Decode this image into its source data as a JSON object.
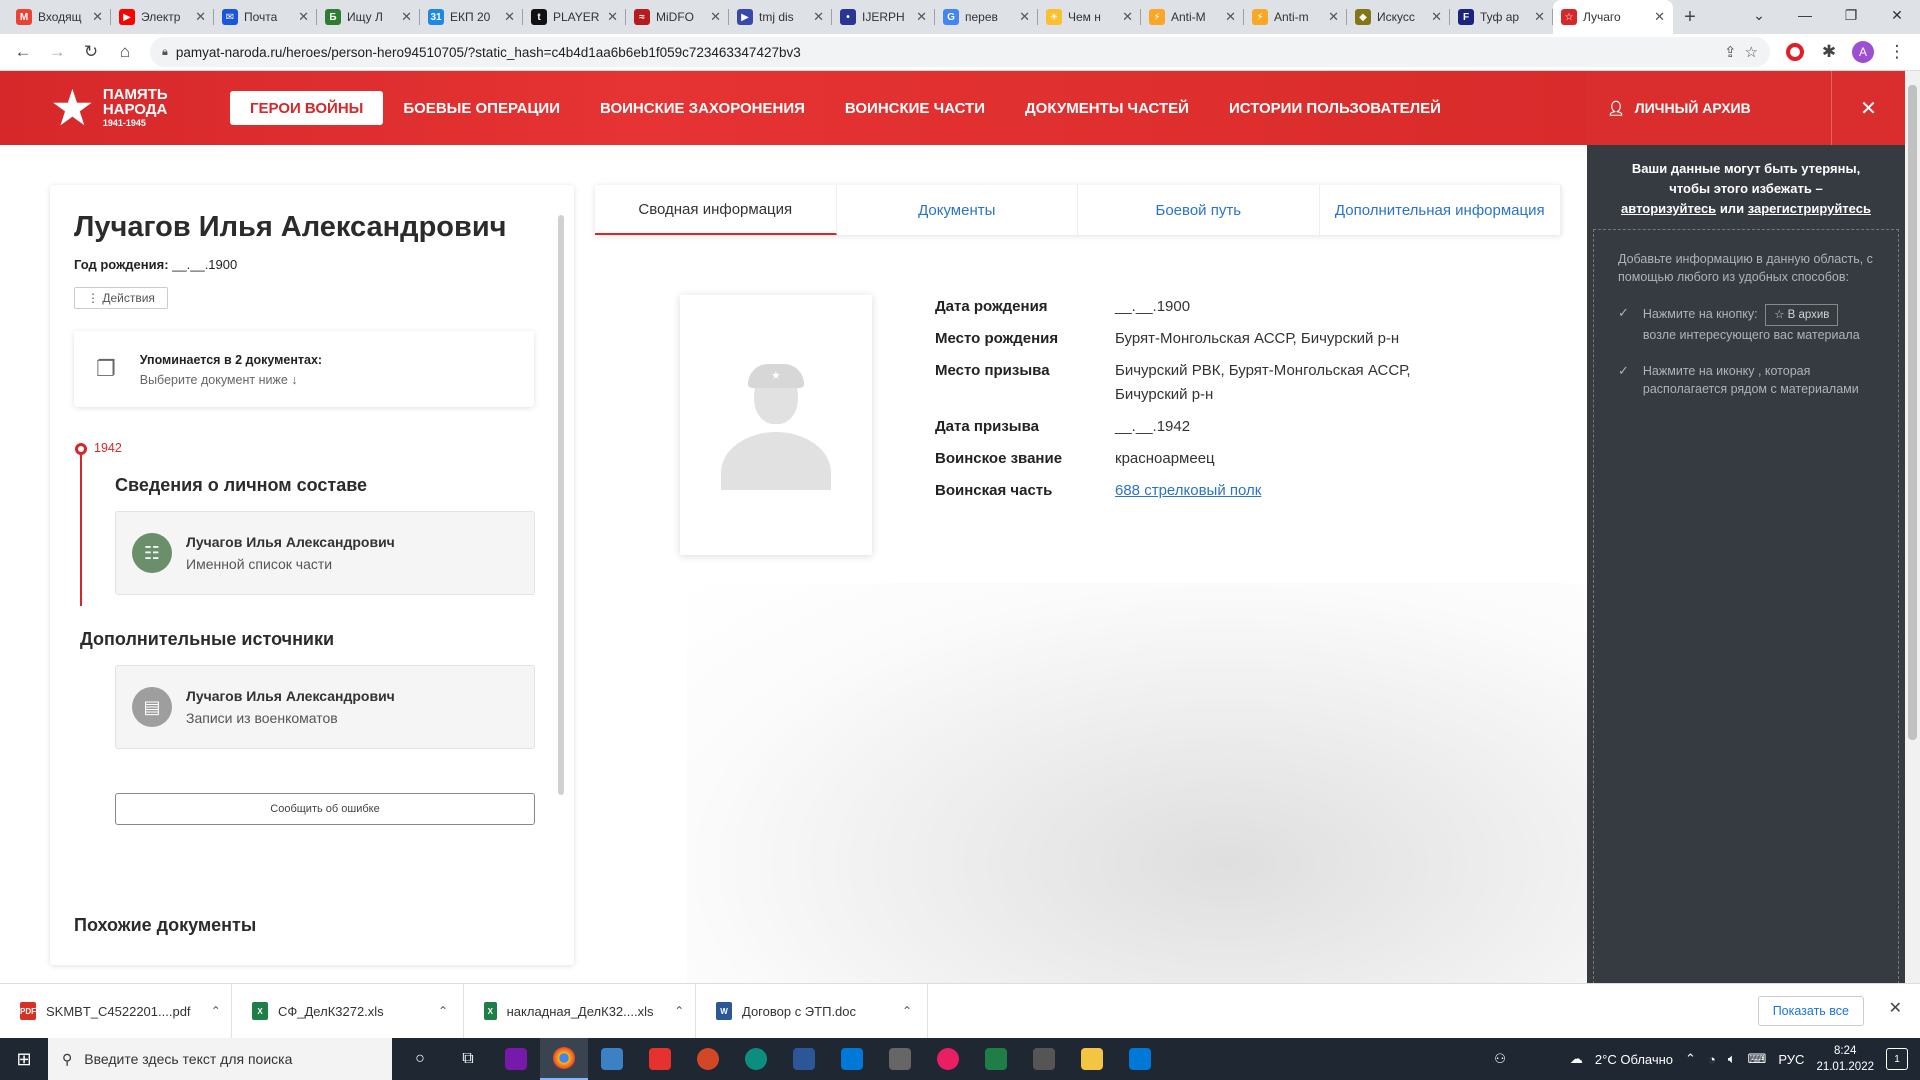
{
  "browser": {
    "tabs": [
      {
        "title": "Входящ",
        "icon": "gmail-icon",
        "color": "#ea4335",
        "glyph": "M"
      },
      {
        "title": "Электр",
        "icon": "youtube-icon",
        "color": "#ff0000",
        "glyph": "▶"
      },
      {
        "title": "Почта",
        "icon": "mail-icon",
        "color": "#1a56db",
        "glyph": "✉"
      },
      {
        "title": "Ищу Л",
        "icon": "b-icon",
        "color": "#2e7d32",
        "glyph": "Б"
      },
      {
        "title": "ЕКП 20",
        "icon": "calendar-icon",
        "color": "#1e88e5",
        "glyph": "31"
      },
      {
        "title": "PLAYER",
        "icon": "player-icon",
        "color": "#111111",
        "glyph": "t"
      },
      {
        "title": "MiDFO",
        "icon": "car-icon",
        "color": "#b71c1c",
        "glyph": "≈"
      },
      {
        "title": "tmj dis",
        "icon": "play-icon",
        "color": "#3949ab",
        "glyph": "▶"
      },
      {
        "title": "IJERPH",
        "icon": "lock-icon",
        "color": "#283593",
        "glyph": "•"
      },
      {
        "title": "перев",
        "icon": "google-icon",
        "color": "#4285f4",
        "glyph": "G"
      },
      {
        "title": "Чем н",
        "icon": "sun-icon",
        "color": "#fbc02d",
        "glyph": "☀"
      },
      {
        "title": "Anti-M",
        "icon": "antim-icon",
        "color": "#f9a825",
        "glyph": "⚡"
      },
      {
        "title": "Anti-m",
        "icon": "antim-icon",
        "color": "#f9a825",
        "glyph": "⚡"
      },
      {
        "title": "Искусс",
        "icon": "diamond-icon",
        "color": "#827717",
        "glyph": "◆"
      },
      {
        "title": "Туф ар",
        "icon": "f-icon",
        "color": "#1a237e",
        "glyph": "F"
      },
      {
        "title": "Лучаго",
        "icon": "star-icon",
        "color": "#d6282a",
        "glyph": "☆"
      }
    ],
    "url": "pamyat-naroda.ru/heroes/person-hero94510705/?static_hash=c4b4d1aa6b6eb1f059c723463347427bv3",
    "profile_letter": "A"
  },
  "site": {
    "logo_line1": "ПАМЯТЬ",
    "logo_line2": "НАРОДА",
    "logo_years": "1941-1945",
    "nav": [
      "ГЕРОИ ВОЙНЫ",
      "БОЕВЫЕ ОПЕРАЦИИ",
      "ВОИНСКИЕ ЗАХОРОНЕНИЯ",
      "ВОИНСКИЕ ЧАСТИ",
      "ДОКУМЕНТЫ ЧАСТЕЙ",
      "ИСТОРИИ ПОЛЬЗОВАТЕЛЕЙ"
    ],
    "archive_title": "ЛИЧНЫЙ АРХИВ"
  },
  "archive": {
    "warn_line1": "Ваши данные могут быть утеряны,",
    "warn_line2": "чтобы этого избежать –",
    "login": "авторизуйтесь",
    "or": "или",
    "register": "зарегистрируйтесь",
    "intro": "Добавьте информацию в данную область, с помощью любого из удобных способов:",
    "step1_pre": "Нажмите на кнопку:",
    "step1_btn": "☆ В архив",
    "step1_post": "возле интересующего вас материала",
    "step2": "Нажмите на иконку , которая располагается рядом с материалами"
  },
  "hero": {
    "name": "Лучагов Илья Александрович",
    "birth_label": "Год рождения:",
    "birth_value": "__.__.1900",
    "actions": "⋮  Действия",
    "mention_title": "Упоминается в 2 документах:",
    "mention_sub": "Выберите документ ниже  ↓",
    "year": "1942",
    "section1": "Сведения о личном составе",
    "source1_name": "Лучагов Илья Александрович",
    "source1_type": "Именной список части",
    "section2": "Дополнительные источники",
    "source2_name": "Лучагов Илья Александрович",
    "source2_type": "Записи из военкоматов",
    "report": "Сообщить об ошибке",
    "similar": "Похожие документы"
  },
  "tabs": [
    "Сводная информация",
    "Документы",
    "Боевой путь",
    "Дополнительная информация"
  ],
  "details": [
    {
      "k": "Дата рождения",
      "v": "__.__.1900"
    },
    {
      "k": "Место рождения",
      "v": "Бурят-Монгольская АССР, Бичурский р-н"
    },
    {
      "k": "Место призыва",
      "v": "Бичурский РВК, Бурят-Монгольская АССР, Бичурский р-н"
    },
    {
      "k": "Дата призыва",
      "v": "__.__.1942"
    },
    {
      "k": "Воинское звание",
      "v": "красноармеец"
    },
    {
      "k": "Воинская часть",
      "v": "688 стрелковый полк",
      "link": true
    }
  ],
  "downloads": [
    {
      "name": "SKMBT_C4522201....pdf",
      "type": "PDF",
      "color": "#d93025"
    },
    {
      "name": "СФ_ДелК3272.xls",
      "type": "X",
      "color": "#1e7e45"
    },
    {
      "name": "накладная_ДелК32....xls",
      "type": "X",
      "color": "#1e7e45"
    },
    {
      "name": "Договор с ЭТП.doc",
      "type": "W",
      "color": "#2b5797"
    }
  ],
  "show_all": "Показать все",
  "taskbar": {
    "search_placeholder": "Введите здесь текст для поиска",
    "weather": "2°C  Облачно",
    "lang": "РУС",
    "time": "8:24",
    "date": "21.01.2022",
    "notif": "1"
  }
}
